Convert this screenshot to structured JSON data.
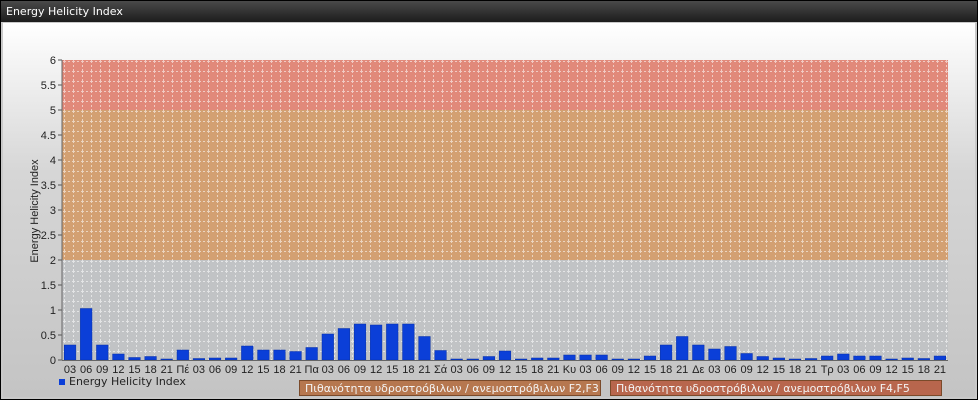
{
  "window": {
    "title": "Energy Helicity Index"
  },
  "legend": {
    "series_label": "Energy Helicity Index",
    "band1": {
      "label": "Πιθανότητα υδροστρόβιλων / ανεμοστρόβιλων F2,F3",
      "color": "#b6774f"
    },
    "band2": {
      "label": "Πιθανότητα υδροστρόβιλων / ανεμοστρόβιλων F4,F5",
      "color": "#b8664d"
    }
  },
  "colors": {
    "bar": "#0b3fd8",
    "band_low": "#c1c3c5",
    "band_mid": "#d3a072",
    "band_high": "#e1897a"
  },
  "chart_data": {
    "type": "bar",
    "ylabel": "Energy Helicity Index",
    "xlabel": "",
    "ylim": [
      0,
      6
    ],
    "yticks": [
      "0",
      "0.5",
      "1",
      "1.5",
      "2",
      "2.5",
      "3",
      "3.5",
      "4",
      "4.5",
      "5",
      "5.5",
      "6"
    ],
    "bands": [
      {
        "from": 0,
        "to": 2,
        "name": "low"
      },
      {
        "from": 2,
        "to": 5,
        "name": "mid"
      },
      {
        "from": 5,
        "to": 6,
        "name": "high"
      }
    ],
    "categories": [
      "03",
      "06",
      "09",
      "12",
      "15",
      "18",
      "21",
      "Πέ",
      "03",
      "06",
      "09",
      "12",
      "15",
      "18",
      "21",
      "Πα",
      "03",
      "06",
      "09",
      "12",
      "15",
      "18",
      "21",
      "Σά",
      "03",
      "06",
      "09",
      "12",
      "15",
      "18",
      "21",
      "Κυ",
      "03",
      "06",
      "09",
      "12",
      "15",
      "18",
      "21",
      "Δε",
      "03",
      "06",
      "09",
      "12",
      "15",
      "18",
      "21",
      "Τρ",
      "03",
      "06",
      "09",
      "12",
      "15",
      "18",
      "21"
    ],
    "values": [
      0.3,
      1.03,
      0.3,
      0.12,
      0.05,
      0.07,
      0.02,
      0.2,
      0.03,
      0.04,
      0.04,
      0.28,
      0.2,
      0.2,
      0.17,
      0.25,
      0.52,
      0.63,
      0.72,
      0.7,
      0.72,
      0.72,
      0.47,
      0.19,
      0.02,
      0.02,
      0.07,
      0.18,
      0.02,
      0.04,
      0.04,
      0.1,
      0.1,
      0.1,
      0.02,
      0.02,
      0.08,
      0.3,
      0.47,
      0.3,
      0.22,
      0.27,
      0.13,
      0.07,
      0.04,
      0.02,
      0.03,
      0.08,
      0.12,
      0.08,
      0.08,
      0.02,
      0.04,
      0.03,
      0.08
    ]
  }
}
